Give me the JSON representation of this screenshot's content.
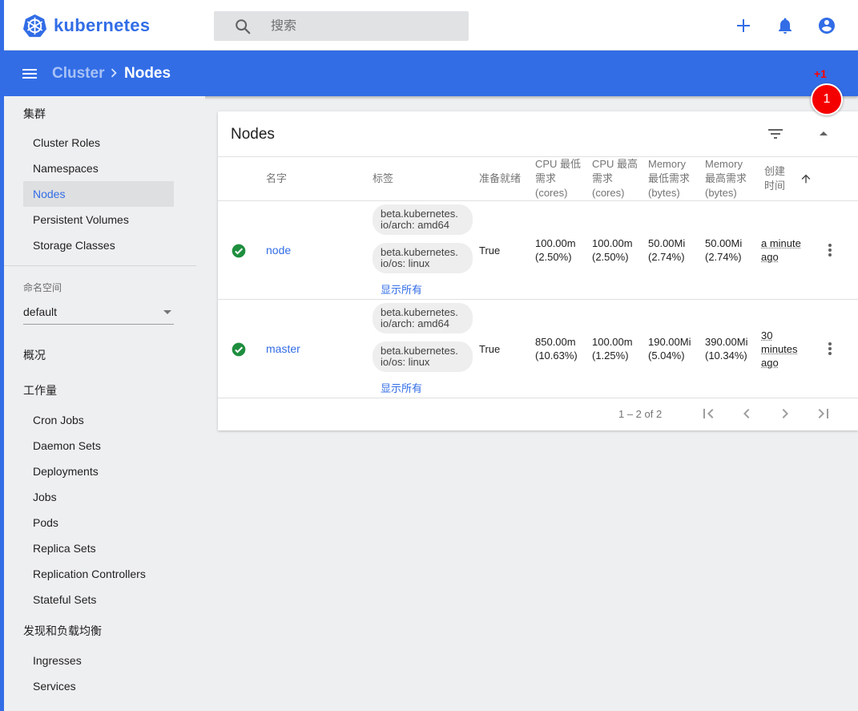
{
  "app": {
    "name": "kubernetes",
    "accent": "#326de6",
    "logo_icon": "kubernetes-helm-icon"
  },
  "search": {
    "placeholder": "搜索"
  },
  "topbar_actions": [
    {
      "name": "create",
      "icon": "plus-icon"
    },
    {
      "name": "notifications",
      "icon": "bell-icon"
    },
    {
      "name": "account",
      "icon": "account-circle-icon"
    }
  ],
  "breadcrumb": {
    "parent": "Cluster",
    "separator_icon": "chevron-right-icon",
    "current": "Nodes"
  },
  "annotation": {
    "increment": "+1",
    "marker_number": "1",
    "color": "#f50000"
  },
  "sidebar": {
    "cluster_heading": "集群",
    "cluster_items": [
      "Cluster Roles",
      "Namespaces",
      "Nodes",
      "Persistent Volumes",
      "Storage Classes"
    ],
    "active_item": "Nodes",
    "namespace_label": "命名空间",
    "namespace_value": "default",
    "overview": "概况",
    "workloads_heading": "工作量",
    "workload_items": [
      "Cron Jobs",
      "Daemon Sets",
      "Deployments",
      "Jobs",
      "Pods",
      "Replica Sets",
      "Replication Controllers",
      "Stateful Sets"
    ],
    "discovery_heading": "发现和负载均衡",
    "discovery_items": [
      "Ingresses",
      "Services"
    ]
  },
  "card": {
    "title": "Nodes",
    "filter_icon": "filter-list-icon",
    "collapse_icon": "arrow-drop-up-icon",
    "columns": {
      "name": "名字",
      "labels": "标签",
      "ready": "准备就绪",
      "cpu_requests": [
        "CPU 最低",
        "需求",
        "(cores)"
      ],
      "cpu_limits": [
        "CPU 最高",
        "需求",
        "(cores)"
      ],
      "mem_requests": [
        "Memory",
        "最低需求",
        "(bytes)"
      ],
      "mem_limits": [
        "Memory",
        "最高需求",
        "(bytes)"
      ],
      "created": [
        "创建",
        "时间"
      ]
    },
    "sort_icon": "arrow-upward-icon",
    "rows": [
      {
        "status_icon": "check-circle-icon",
        "status_color": "#1e8e3e",
        "name": "node",
        "labels": [
          [
            "beta.kubernetes.",
            "io/arch: amd64"
          ],
          [
            "beta.kubernetes.",
            "io/os: linux"
          ]
        ],
        "show_all": "显示所有",
        "ready": "True",
        "cpu_requests": [
          "100.00m",
          "(2.50%)"
        ],
        "cpu_limits": [
          "100.00m",
          "(2.50%)"
        ],
        "mem_requests": [
          "50.00Mi",
          "(2.74%)"
        ],
        "mem_limits": [
          "50.00Mi",
          "(2.74%)"
        ],
        "created": [
          "a minute",
          "ago"
        ]
      },
      {
        "status_icon": "check-circle-icon",
        "status_color": "#1e8e3e",
        "name": "master",
        "labels": [
          [
            "beta.kubernetes.",
            "io/arch: amd64"
          ],
          [
            "beta.kubernetes.",
            "io/os: linux"
          ]
        ],
        "show_all": "显示所有",
        "ready": "True",
        "cpu_requests": [
          "850.00m",
          "(10.63%)"
        ],
        "cpu_limits": [
          "100.00m",
          "(1.25%)"
        ],
        "mem_requests": [
          "190.00Mi",
          "(5.04%)"
        ],
        "mem_limits": [
          "390.00Mi",
          "(10.34%)"
        ],
        "created": [
          "30",
          "minutes",
          "ago"
        ]
      }
    ],
    "row_action_icon": "more-vert-icon",
    "pagination": {
      "range": "1 – 2 of 2",
      "buttons": [
        "first-page-icon",
        "chevron-left-icon",
        "chevron-right-icon",
        "last-page-icon"
      ]
    }
  }
}
